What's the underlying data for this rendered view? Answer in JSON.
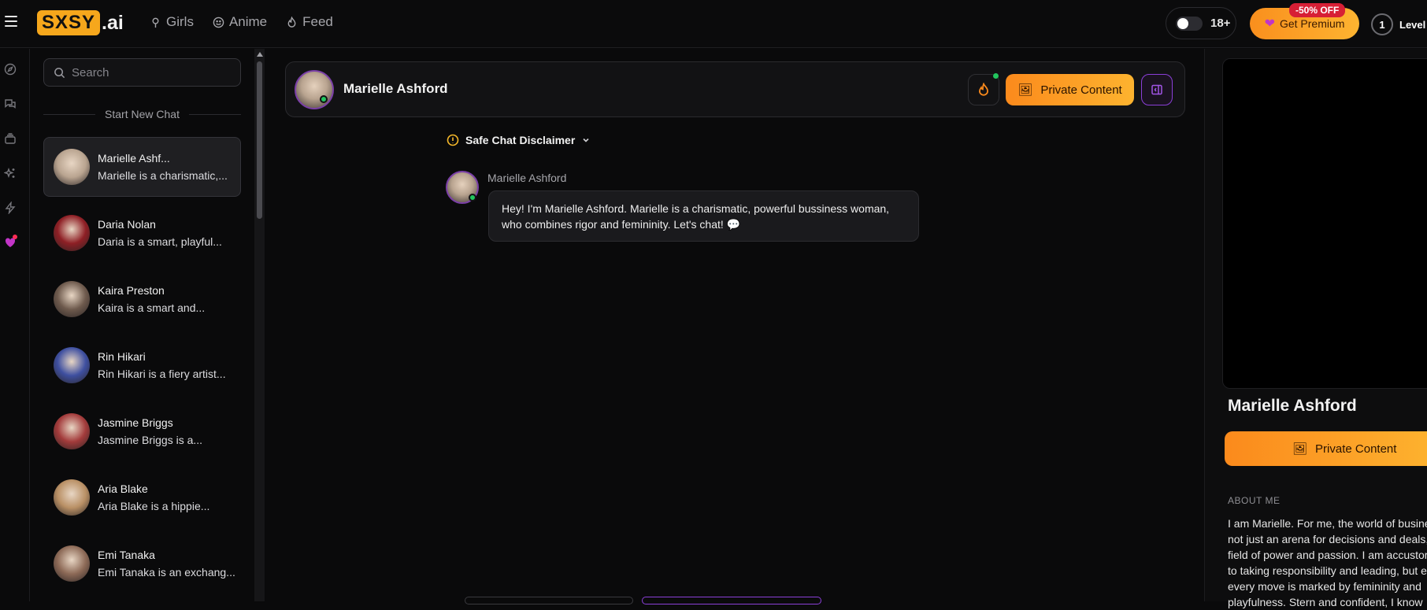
{
  "nav": {
    "logo_box": "SXSY",
    "logo_suffix": ".ai",
    "links": [
      {
        "label": "Girls",
        "icon": "pin-icon"
      },
      {
        "label": "Anime",
        "icon": "smile-icon"
      },
      {
        "label": "Feed",
        "icon": "flame-icon"
      }
    ],
    "age_label": "18+",
    "premium_label": "Get Premium",
    "discount_badge": "-50% OFF",
    "level_number": "1",
    "level_label": "Level"
  },
  "sidebar": {
    "search_placeholder": "Search",
    "section_title": "Start New Chat",
    "chats": [
      {
        "name": "Marielle Ashf...",
        "preview": "Marielle is a charismatic,...",
        "active": true,
        "avatar_color": "#b9a490"
      },
      {
        "name": "Daria Nolan",
        "preview": "Daria is a smart, playful...",
        "active": false,
        "avatar_color": "#8e1f25"
      },
      {
        "name": "Kaira Preston",
        "preview": "Kaira is a smart and...",
        "active": false,
        "avatar_color": "#6e5a4d"
      },
      {
        "name": "Rin Hikari",
        "preview": "Rin Hikari is a fiery artist...",
        "active": false,
        "avatar_color": "#3e4fa0"
      },
      {
        "name": "Jasmine Briggs",
        "preview": "Jasmine Briggs is a...",
        "active": false,
        "avatar_color": "#a33b3b"
      },
      {
        "name": "Aria Blake",
        "preview": "Aria Blake is a hippie...",
        "active": false,
        "avatar_color": "#b99065"
      },
      {
        "name": "Emi Tanaka",
        "preview": "Emi Tanaka is an exchang...",
        "active": false,
        "avatar_color": "#8d6a57"
      }
    ]
  },
  "chat": {
    "header_name": "Marielle Ashford",
    "private_content_label": "Private Content",
    "disclaimer": "Safe Chat Disclaimer",
    "message_sender": "Marielle Ashford",
    "message_text": "Hey! I'm Marielle Ashford. Marielle is a charismatic, powerful bussiness woman, who combines rigor and femininity. Let's chat! 💬"
  },
  "profile": {
    "name": "Marielle Ashford",
    "private_content_label": "Private Content",
    "about_label": "ABOUT ME",
    "about_lines": [
      "I am Marielle. For me, the world of business is",
      "not just an arena for decisions and deals, but a",
      "field of power and passion. I am accustomed",
      "to taking responsibility and leading, but even",
      "every move is marked by femininity and",
      "playfulness. Stern and confident, I know"
    ]
  },
  "colors": {
    "accent_orange": "#fb8a1c",
    "accent_purple": "#8b3fd8",
    "online_green": "#22c55e",
    "discount_red": "#d71f35"
  }
}
